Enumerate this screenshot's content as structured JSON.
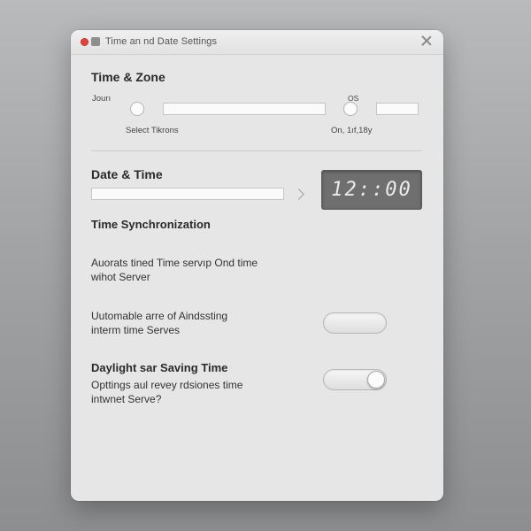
{
  "window": {
    "title": "Time an nd Date Settings"
  },
  "time_zone": {
    "heading": "Time & Zone",
    "left_label": "Jourı",
    "right_label": "OS",
    "select_caption": "Select Tikrons",
    "on_caption": "On, 1ıf,18y"
  },
  "date_time": {
    "heading": "Date & Time",
    "clock_value": "12::00"
  },
  "sync": {
    "heading": "Time Synchronization",
    "desc_line1": "Auorats tined Time servıp Ond time",
    "desc_line2": "wihot Server"
  },
  "internet_time": {
    "line1": "Uutomable arre of Aindssting",
    "line2": "interm time Serves",
    "toggle_on": false
  },
  "dst": {
    "heading": "Daylight sar Saving Time",
    "line1": "Opttings aul revey rdsiones time",
    "line2": "intwnet Serve?",
    "toggle_on": true
  }
}
